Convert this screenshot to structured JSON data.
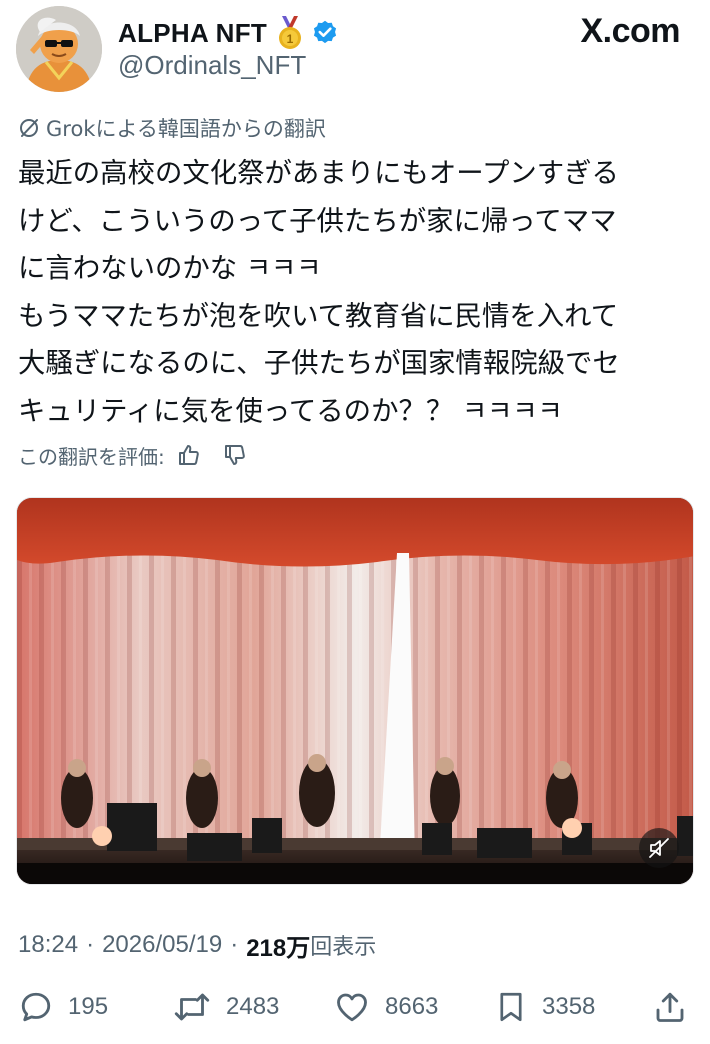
{
  "site": {
    "logo_text": "X.com"
  },
  "author": {
    "display_name": "ALPHA NFT",
    "handle": "@Ordinals_NFT",
    "badges": [
      "gold-medal-icon",
      "verified-badge-icon"
    ]
  },
  "translation_note": "Grokによる韓国語からの翻訳",
  "post_lines": [
    "最近の高校の文化祭があまりにもオープンすぎる",
    "けど、こういうのって子供たちが家に帰ってママ",
    "に言わないのかな ㅋㅋㅋ",
    "もうママたちが泡を吹いて教育省に民情を入れて",
    "大騒ぎになるのに、子供たちが国家情報院級でセ",
    "キュリティに気を使ってるのか？？ ㅋㅋㅋㅋ"
  ],
  "rate_label": "この翻訳を評価:",
  "meta": {
    "time": "18:24",
    "date": "2026/05/19",
    "separator": "·",
    "views": "218万",
    "views_label": "回表示"
  },
  "actions": {
    "replies": "195",
    "reposts": "2483",
    "likes": "8663",
    "bookmarks": "3358"
  },
  "colors": {
    "text": "#0f1419",
    "secondary": "#536471",
    "verified": "#1d9bf0",
    "medal": "#e8b21e"
  }
}
